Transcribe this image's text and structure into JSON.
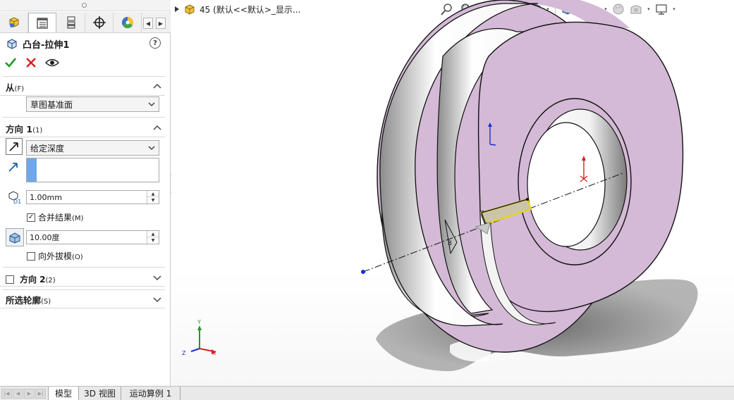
{
  "property_manager": {
    "tabs": [
      {
        "name": "feature-manager-tab",
        "icon": "feature-tree-icon"
      },
      {
        "name": "property-manager-tab",
        "icon": "property-list-icon"
      },
      {
        "name": "configuration-manager-tab",
        "icon": "configuration-icon"
      },
      {
        "name": "dimxpert-manager-tab",
        "icon": "crosshair-icon"
      },
      {
        "name": "display-manager-tab",
        "icon": "color-wheel-icon"
      }
    ],
    "title": "凸台-拉伸1",
    "help_label": "?",
    "from_section": {
      "label": "从",
      "shortcut": "(F)",
      "start_condition": "草图基准面"
    },
    "direction1_section": {
      "label": "方向 1",
      "shortcut": "(1)",
      "end_condition": "给定深度",
      "depth_value": "1.00mm",
      "merge_result_label": "合并结果",
      "merge_result_shortcut": "(M)",
      "merge_result_checked": true,
      "draft_angle_value": "10.00度",
      "draft_outward_label": "向外拔模",
      "draft_outward_shortcut": "(O)",
      "draft_outward_checked": false
    },
    "direction2_section": {
      "label": "方向 2",
      "shortcut": "(2)",
      "checked": false
    },
    "selected_contours_section": {
      "label": "所选轮廓",
      "shortcut": "(S)"
    }
  },
  "viewport": {
    "tree_flyout_text": "45  (默认<<默认>_显示...",
    "toolbar_icons": [
      "zoom-to-fit-icon",
      "zoom-area-icon",
      "previous-view-icon",
      "section-view-icon",
      "dynamic-annotation-icon",
      "view-orientation-icon",
      "display-style-icon",
      "hide-show-items-icon",
      "edit-appearance-icon",
      "apply-scene-icon",
      "view-settings-icon"
    ],
    "triad": {
      "x_label": "X",
      "y_label": "Y",
      "z_label": "Z"
    },
    "colors": {
      "face_fill": "#d4bad6",
      "edge": "#111111",
      "preview_yellow": "#e8d800",
      "x_axis": "#d62020",
      "y_axis": "#18a018",
      "z_axis": "#1a2ed8"
    }
  },
  "bottom_tabs": {
    "items": [
      "模型",
      "3D 视图",
      "运动算例 1"
    ],
    "active_index": 0
  }
}
